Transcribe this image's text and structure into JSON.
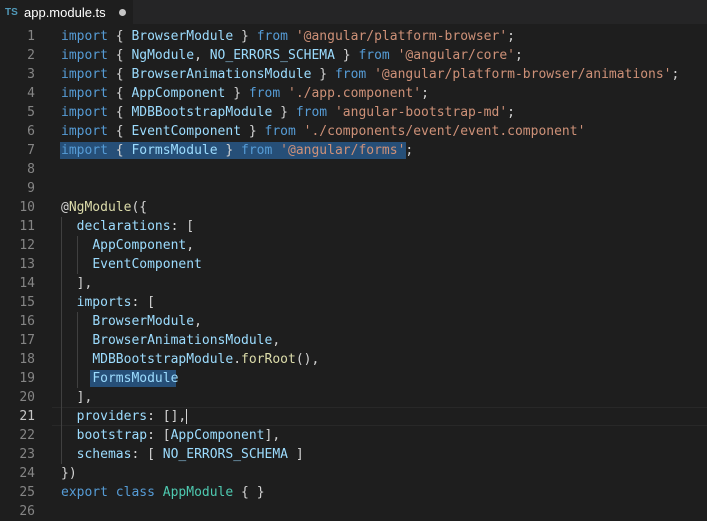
{
  "tab": {
    "icon": "TS",
    "title": "app.module.ts"
  },
  "line_numbers": [
    "1",
    "2",
    "3",
    "4",
    "5",
    "6",
    "7",
    "8",
    "9",
    "10",
    "11",
    "12",
    "13",
    "14",
    "15",
    "16",
    "17",
    "18",
    "19",
    "20",
    "21",
    "22",
    "23",
    "24",
    "25",
    "26"
  ],
  "lines": [
    [
      [
        "kw",
        "import"
      ],
      [
        "pn",
        " { "
      ],
      [
        "vr",
        "BrowserModule"
      ],
      [
        "pn",
        " } "
      ],
      [
        "kw",
        "from"
      ],
      [
        "pn",
        " "
      ],
      [
        "st",
        "'@angular/platform-browser'"
      ],
      [
        "pn",
        ";"
      ]
    ],
    [
      [
        "kw",
        "import"
      ],
      [
        "pn",
        " { "
      ],
      [
        "vr",
        "NgModule"
      ],
      [
        "pn",
        ", "
      ],
      [
        "vr",
        "NO_ERRORS_SCHEMA"
      ],
      [
        "pn",
        " } "
      ],
      [
        "kw",
        "from"
      ],
      [
        "pn",
        " "
      ],
      [
        "st",
        "'@angular/core'"
      ],
      [
        "pn",
        ";"
      ]
    ],
    [
      [
        "kw",
        "import"
      ],
      [
        "pn",
        " { "
      ],
      [
        "vr",
        "BrowserAnimationsModule"
      ],
      [
        "pn",
        " } "
      ],
      [
        "kw",
        "from"
      ],
      [
        "pn",
        " "
      ],
      [
        "st",
        "'@angular/platform-browser/animations'"
      ],
      [
        "pn",
        ";"
      ]
    ],
    [
      [
        "kw",
        "import"
      ],
      [
        "pn",
        " { "
      ],
      [
        "vr",
        "AppComponent"
      ],
      [
        "pn",
        " } "
      ],
      [
        "kw",
        "from"
      ],
      [
        "pn",
        " "
      ],
      [
        "st",
        "'./app.component'"
      ],
      [
        "pn",
        ";"
      ]
    ],
    [
      [
        "kw",
        "import"
      ],
      [
        "pn",
        " { "
      ],
      [
        "vr",
        "MDBBootstrapModule"
      ],
      [
        "pn",
        " } "
      ],
      [
        "kw",
        "from"
      ],
      [
        "pn",
        " "
      ],
      [
        "st",
        "'angular-bootstrap-md'"
      ],
      [
        "pn",
        ";"
      ]
    ],
    [
      [
        "kw",
        "import"
      ],
      [
        "pn",
        " { "
      ],
      [
        "vr",
        "EventComponent"
      ],
      [
        "pn",
        " } "
      ],
      [
        "kw",
        "from"
      ],
      [
        "pn",
        " "
      ],
      [
        "st",
        "'./components/event/event.component'"
      ]
    ],
    [
      [
        "kw",
        "import"
      ],
      [
        "pn",
        " { "
      ],
      [
        "vr",
        "FormsModule"
      ],
      [
        "pn",
        " } "
      ],
      [
        "kw",
        "from"
      ],
      [
        "pn",
        " "
      ],
      [
        "st",
        "'@angular/forms'"
      ],
      [
        "pn",
        ";"
      ]
    ],
    [],
    [],
    [
      [
        "pn",
        "@"
      ],
      [
        "fn",
        "NgModule"
      ],
      [
        "pn",
        "({"
      ]
    ],
    [
      [
        "pn",
        "  "
      ],
      [
        "vr",
        "declarations"
      ],
      [
        "pn",
        ": ["
      ]
    ],
    [
      [
        "pn",
        "    "
      ],
      [
        "vr",
        "AppComponent"
      ],
      [
        "pn",
        ","
      ]
    ],
    [
      [
        "pn",
        "    "
      ],
      [
        "vr",
        "EventComponent"
      ]
    ],
    [
      [
        "pn",
        "  ],"
      ]
    ],
    [
      [
        "pn",
        "  "
      ],
      [
        "vr",
        "imports"
      ],
      [
        "pn",
        ": ["
      ]
    ],
    [
      [
        "pn",
        "    "
      ],
      [
        "vr",
        "BrowserModule"
      ],
      [
        "pn",
        ","
      ]
    ],
    [
      [
        "pn",
        "    "
      ],
      [
        "vr",
        "BrowserAnimationsModule"
      ],
      [
        "pn",
        ","
      ]
    ],
    [
      [
        "pn",
        "    "
      ],
      [
        "vr",
        "MDBBootstrapModule"
      ],
      [
        "pn",
        "."
      ],
      [
        "fn",
        "forRoot"
      ],
      [
        "pn",
        "(),"
      ]
    ],
    [
      [
        "pn",
        "    "
      ],
      [
        "vr",
        "FormsModule"
      ]
    ],
    [
      [
        "pn",
        "  ],"
      ]
    ],
    [
      [
        "pn",
        "  "
      ],
      [
        "vr",
        "providers"
      ],
      [
        "pn",
        ": [],"
      ]
    ],
    [
      [
        "pn",
        "  "
      ],
      [
        "vr",
        "bootstrap"
      ],
      [
        "pn",
        ": ["
      ],
      [
        "vr",
        "AppComponent"
      ],
      [
        "pn",
        "],"
      ]
    ],
    [
      [
        "pn",
        "  "
      ],
      [
        "vr",
        "schemas"
      ],
      [
        "pn",
        ": [ "
      ],
      [
        "vr",
        "NO_ERRORS_SCHEMA"
      ],
      [
        "pn",
        " ]"
      ]
    ],
    [
      [
        "pn",
        "})"
      ]
    ],
    [
      [
        "kw",
        "export"
      ],
      [
        "pn",
        " "
      ],
      [
        "kw",
        "class"
      ],
      [
        "pn",
        " "
      ],
      [
        "tp",
        "AppModule"
      ],
      [
        "pn",
        " { }"
      ]
    ],
    []
  ],
  "active_line": "21",
  "selected_line": "7",
  "colors": {
    "background": "#1e1e1e",
    "keyword": "#569cd6",
    "string": "#ce9178",
    "type": "#4ec9b0",
    "variable": "#9cdcfe",
    "function": "#dcdcaa",
    "punctuation": "#d4d4d4",
    "selection": "#264f78"
  }
}
